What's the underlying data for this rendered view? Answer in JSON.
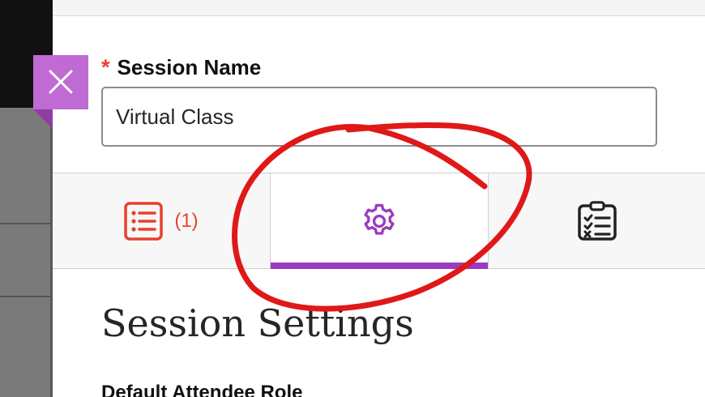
{
  "form": {
    "required_mark": "*",
    "session_name_label": "Session Name",
    "session_name_value": "Virtual Class"
  },
  "tabs": [
    {
      "icon": "list-icon",
      "count": "(1)",
      "selected": false,
      "color": "#e8412b"
    },
    {
      "icon": "gear-icon",
      "selected": true,
      "color": "#9b3bbf"
    },
    {
      "icon": "clipboard-checklist-icon",
      "selected": false,
      "color": "#222222"
    }
  ],
  "section": {
    "title": "Session Settings",
    "subheading": "Default Attendee Role"
  },
  "colors": {
    "accent": "#9b3bbf",
    "close_button": "#c06ad4",
    "error": "#e8412b",
    "annotation": "#e01818"
  },
  "annotation": {
    "shape": "hand-drawn red circle around settings tab"
  }
}
